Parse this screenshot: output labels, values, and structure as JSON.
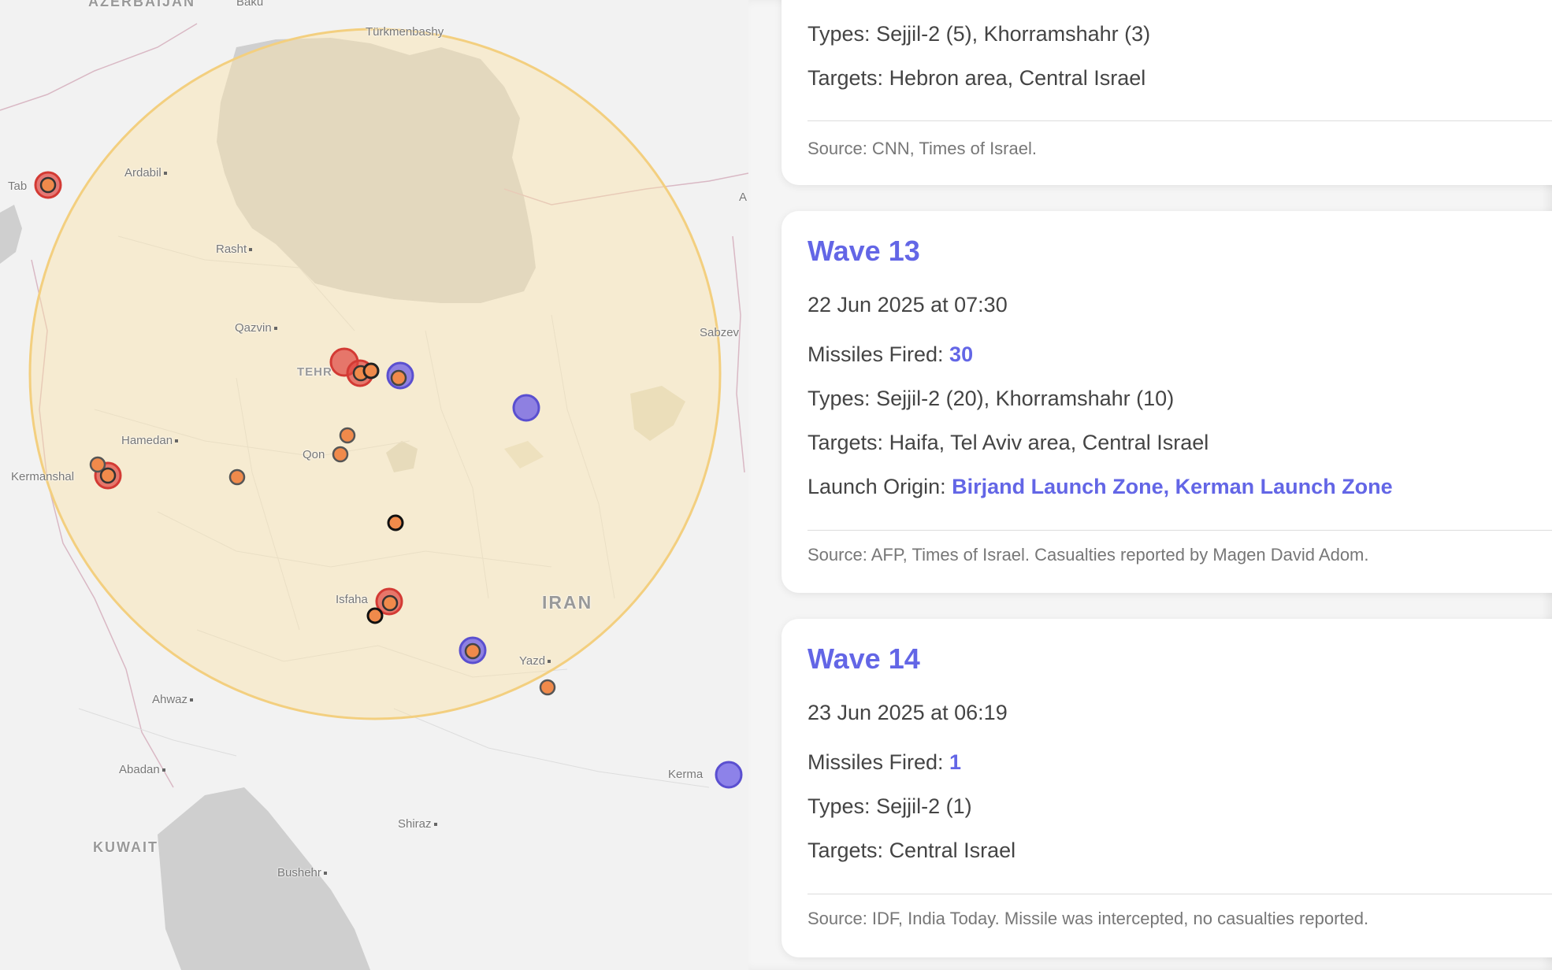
{
  "map": {
    "countries": [
      {
        "id": "azerbaijan",
        "label": "AZERBAIJAN"
      },
      {
        "id": "iran",
        "label": "IRAN"
      },
      {
        "id": "kuwait",
        "label": "KUWAIT"
      }
    ],
    "cities": [
      {
        "id": "baku",
        "label": "Baku"
      },
      {
        "id": "turkmenbashy",
        "label": "Türkmenbashy"
      },
      {
        "id": "ardabil",
        "label": "Ardabil"
      },
      {
        "id": "tabriz",
        "label": "Tab"
      },
      {
        "id": "rasht",
        "label": "Rasht"
      },
      {
        "id": "qazvin",
        "label": "Qazvin"
      },
      {
        "id": "tehran",
        "label": "TEHR"
      },
      {
        "id": "sabzevar",
        "label": "Sabzev"
      },
      {
        "id": "hamedan",
        "label": "Hamedan"
      },
      {
        "id": "qom",
        "label": "Qon"
      },
      {
        "id": "kermanshah",
        "label": "Kermanshal"
      },
      {
        "id": "isfahan",
        "label": "Isfaha"
      },
      {
        "id": "yazd",
        "label": "Yazd"
      },
      {
        "id": "ahwaz",
        "label": "Ahwaz"
      },
      {
        "id": "abadan",
        "label": "Abadan"
      },
      {
        "id": "kerman",
        "label": "Kerma"
      },
      {
        "id": "shiraz",
        "label": "Shiraz"
      },
      {
        "id": "bushehr",
        "label": "Bushehr"
      },
      {
        "id": "edge-a",
        "label": "A"
      }
    ],
    "colors": {
      "range_fill": "#fbe3a8",
      "range_stroke": "#f3cf7f",
      "site_red": "#e0453f",
      "site_orange": "#f08a4b",
      "site_blue": "#6b5ce6",
      "water": "#cfcfcf",
      "land": "#f2f2f2"
    }
  },
  "waves": [
    {
      "id": "wave-12",
      "types_label": "Types:",
      "types": "Sejjil-2 (5), Khorramshahr (3)",
      "targets_label": "Targets:",
      "targets": "Hebron area, Central Israel",
      "source": "Source: CNN, Times of Israel."
    },
    {
      "id": "wave-13",
      "title": "Wave 13",
      "datetime": "22 Jun 2025 at 07:30",
      "missiles_label": "Missiles Fired:",
      "missiles": "30",
      "types_label": "Types:",
      "types": "Sejjil-2 (20), Khorramshahr (10)",
      "targets_label": "Targets:",
      "targets": "Haifa, Tel Aviv area, Central Israel",
      "origin_label": "Launch Origin:",
      "origin": "Birjand Launch Zone, Kerman Launch Zone",
      "source": "Source: AFP, Times of Israel. Casualties reported by Magen David Adom."
    },
    {
      "id": "wave-14",
      "title": "Wave 14",
      "datetime": "23 Jun 2025 at 06:19",
      "missiles_label": "Missiles Fired:",
      "missiles": "1",
      "types_label": "Types:",
      "types": "Sejjil-2 (1)",
      "targets_label": "Targets:",
      "targets": "Central Israel",
      "source": "Source: IDF, India Today. Missile was intercepted, no casualties reported."
    }
  ]
}
